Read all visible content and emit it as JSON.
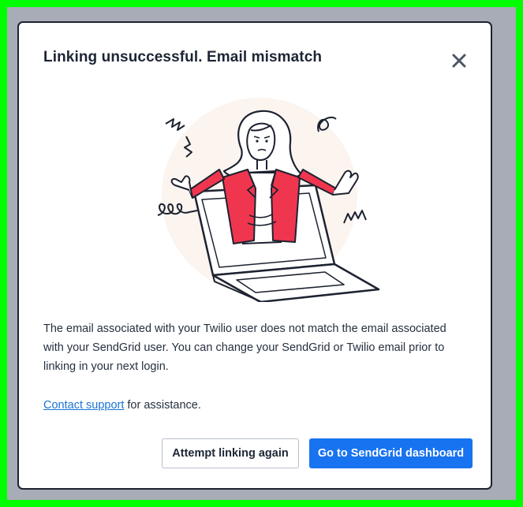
{
  "dialog": {
    "title": "Linking unsuccessful. Email mismatch",
    "close_icon": "close-icon",
    "illustration_icon": "confused-person-laptop-illustration",
    "message": "The email associated with your Twilio user does not match the email associated with your SendGrid user. You can change your SendGrid or Twilio email prior to linking in your next login.",
    "support_link_label": "Contact support",
    "support_suffix": " for assistance.",
    "secondary_button_label": "Attempt linking again",
    "primary_button_label": "Go to SendGrid dashboard"
  },
  "colors": {
    "accent": "#1873f0",
    "link": "#1a73d6",
    "jacket": "#f0364f",
    "backdrop": "#a7acb6",
    "frame": "#00ff00"
  }
}
